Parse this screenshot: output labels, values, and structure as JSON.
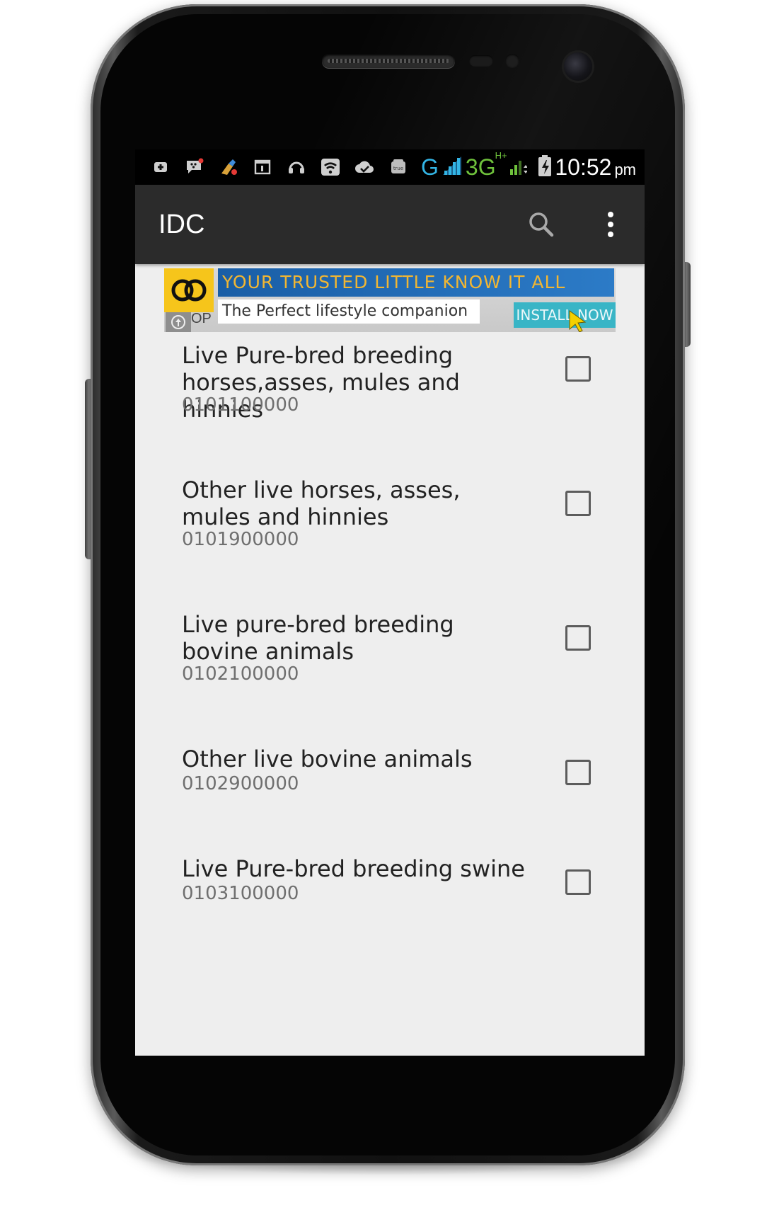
{
  "status_bar": {
    "icons": [
      "add-icon",
      "bbm-icon",
      "paint-icon",
      "calendar-icon",
      "headset-icon",
      "wifi-icon",
      "cloud-check-icon",
      "truemove-icon"
    ],
    "network_g": "G",
    "network_3g": "3G",
    "network_3g_badge": "H+",
    "time": "10:52",
    "time_suffix": "pm"
  },
  "action_bar": {
    "title": "IDC",
    "search_icon": "search-icon",
    "overflow_icon": "more-vert-icon"
  },
  "ad": {
    "headline": "YOUR TRUSTED LITTLE KNOW IT ALL",
    "subline": "The Perfect lifestyle companion",
    "cta": "INSTALL NOW",
    "logo_label": "OP"
  },
  "items": [
    {
      "title": "Live Pure-bred breeding horses,asses, mules and hinnies",
      "code": "0101100000",
      "checked": false
    },
    {
      "title": "Other live horses, asses, mules and hinnies",
      "code": "0101900000",
      "checked": false
    },
    {
      "title": "Live pure-bred breeding bovine animals",
      "code": "0102100000",
      "checked": false
    },
    {
      "title": "Other live bovine animals",
      "code": "0102900000",
      "checked": false
    },
    {
      "title": "Live Pure-bred breeding swine",
      "code": "0103100000",
      "checked": false
    }
  ],
  "colors": {
    "status_bar_bg": "#000000",
    "action_bar_bg": "#2b2b2b",
    "screen_bg": "#eeeeee",
    "network_blue": "#33b5e5",
    "network_green": "#6fc23c",
    "ad_yellow": "#f6c51b",
    "ad_blue": "#1a5ea6",
    "ad_install": "#39b5c6"
  }
}
